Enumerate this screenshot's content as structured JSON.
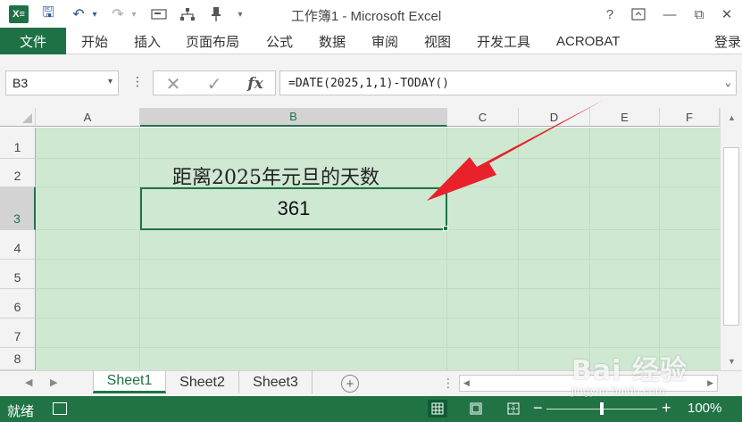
{
  "window": {
    "title": "工作簿1 - Microsoft Excel",
    "help": "?",
    "minimize": "—",
    "restore": "⧉",
    "close": "✕"
  },
  "quick_access": {
    "logo": "X≡",
    "save": "🖫",
    "undo": "↶",
    "redo": "↷",
    "dropdown": "▾"
  },
  "ribbon": {
    "file": "文件",
    "tabs": [
      "开始",
      "插入",
      "页面布局",
      "公式",
      "数据",
      "审阅",
      "视图",
      "开发工具",
      "ACROBAT"
    ],
    "login": "登录"
  },
  "formula_bar": {
    "name_box": "B3",
    "name_box_arrow": "▾",
    "dots": "⋮",
    "cancel": "✕",
    "enter": "✓",
    "fx": "fx",
    "formula": "=DATE(2025,1,1)-TODAY()",
    "expand": "⌄"
  },
  "columns": [
    "A",
    "B",
    "C",
    "D",
    "E",
    "F"
  ],
  "rows": [
    "1",
    "2",
    "3",
    "4",
    "5",
    "6",
    "7",
    "8"
  ],
  "cells": {
    "B2": "距离2025年元旦的天数",
    "B3": "361"
  },
  "sheets": {
    "nav_prev": "◀",
    "nav_next": "▶",
    "tabs": [
      "Sheet1",
      "Sheet2",
      "Sheet3"
    ],
    "active": "Sheet1",
    "add": "+"
  },
  "status": {
    "ready": "就绪",
    "zoom_minus": "−",
    "zoom_plus": "+",
    "zoom": "100%",
    "zoom_level_percent": 100
  },
  "watermark": {
    "main": "Bai  经验",
    "sub": "jingyan.baidu.com"
  },
  "colors": {
    "excel_green": "#217346",
    "grid_fill": "#cfe8d2",
    "arrow_red": "#e8212b"
  }
}
